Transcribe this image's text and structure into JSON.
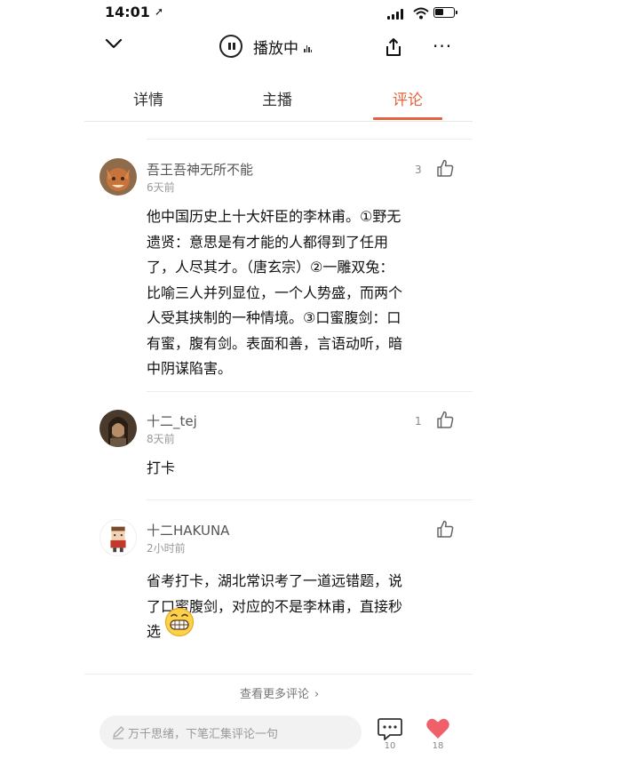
{
  "status_bar": {
    "time": "14:01",
    "location_glyph": "➚"
  },
  "header": {
    "play_status": "播放中",
    "back_icon": "chevron-down-icon",
    "share_icon": "share-icon",
    "more_label": "···"
  },
  "tabs": [
    {
      "label": "详情",
      "active": false
    },
    {
      "label": "主播",
      "active": false
    },
    {
      "label": "评论",
      "active": true
    }
  ],
  "accent_color": "#e4633f",
  "comments": [
    {
      "user": "吾王吾神无所不能",
      "time": "6天前",
      "likes": "3",
      "lines": [
        "他中国历史上十大奸臣的李林甫。①野无",
        "遗贤：意思是有才能的人都得到了任用",
        "了，人尽其才。（唐玄宗）②一雕双兔：",
        "比喻三人并列显位，一个人势盛，而两个",
        "人受其挟制的一种情境。③口蜜腹剑：口",
        "有蜜，腹有剑。表面和善，言语动听，暗",
        "中阴谋陷害。"
      ]
    },
    {
      "user": "十二_tej",
      "time": "8天前",
      "likes": "1",
      "lines": [
        "打卡"
      ]
    },
    {
      "user": "十二HAKUNA",
      "time": "2小时前",
      "likes": "",
      "lines": [
        "省考打卡，湖北常识考了一道远错题，说",
        "了口蜜腹剑，对应的不是李林甫，直接秒",
        "选"
      ],
      "emoji": "grinning-emoji"
    }
  ],
  "more_comments": {
    "label": "查看更多评论",
    "chevron": "›"
  },
  "bottom_bar": {
    "placeholder": "万千思绪，下笔汇集评论一句",
    "comment_count": "10",
    "like_count": "18",
    "like_color": "#f0606a"
  }
}
